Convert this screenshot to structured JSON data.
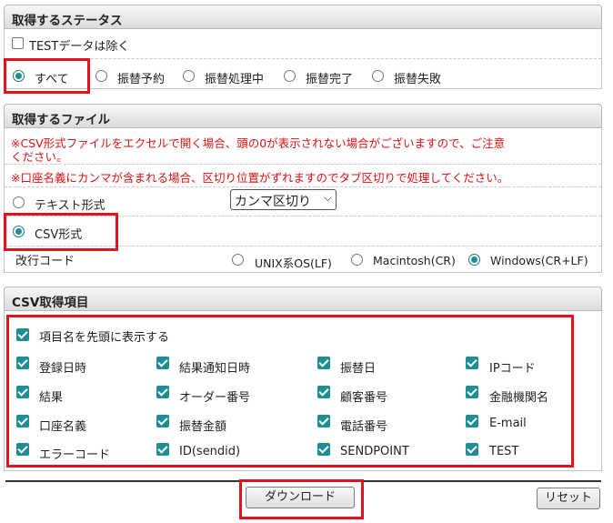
{
  "status_section": {
    "title": "取得するステータス",
    "exclude_test_label": "TESTデータは除く",
    "options": [
      "すべて",
      "振替予約",
      "振替処理中",
      "振替完了",
      "振替失敗"
    ],
    "selected": "すべて"
  },
  "file_section": {
    "title": "取得するファイル",
    "notes": [
      "※CSV形式ファイルをエクセルで開く場合、頭の0が表示されない場合がございますので、ご注意",
      "ください。",
      "※口座名義にカンマが含まれる場合、区切り位置がずれますのでタブ区切りで処理してください。"
    ],
    "text_format_label": "テキスト形式",
    "delimiter_value": "カンマ区切り",
    "csv_format_label": "CSV形式",
    "selected_format": "CSV形式",
    "newline_label": "改行コード",
    "newline_options": [
      "UNIX系OS(LF)",
      "Macintosh(CR)",
      "Windows(CR+LF)"
    ],
    "newline_selected": "Windows(CR+LF)"
  },
  "csv_section": {
    "title": "CSV取得項目",
    "header_row_label": "項目名を先頭に表示する",
    "items": [
      [
        "登録日時",
        "結果通知日時",
        "振替日",
        "IPコード"
      ],
      [
        "結果",
        "オーダー番号",
        "顧客番号",
        "金融機関名"
      ],
      [
        "口座名義",
        "振替金額",
        "電話番号",
        "E-mail"
      ],
      [
        "エラーコード",
        "ID(sendid)",
        "SENDPOINT",
        "TEST"
      ]
    ]
  },
  "buttons": {
    "download": "ダウンロード",
    "reset": "リセット"
  },
  "colors": {
    "accent": "#1f8e94",
    "highlight": "#e0141e",
    "note": "#dd1111"
  }
}
